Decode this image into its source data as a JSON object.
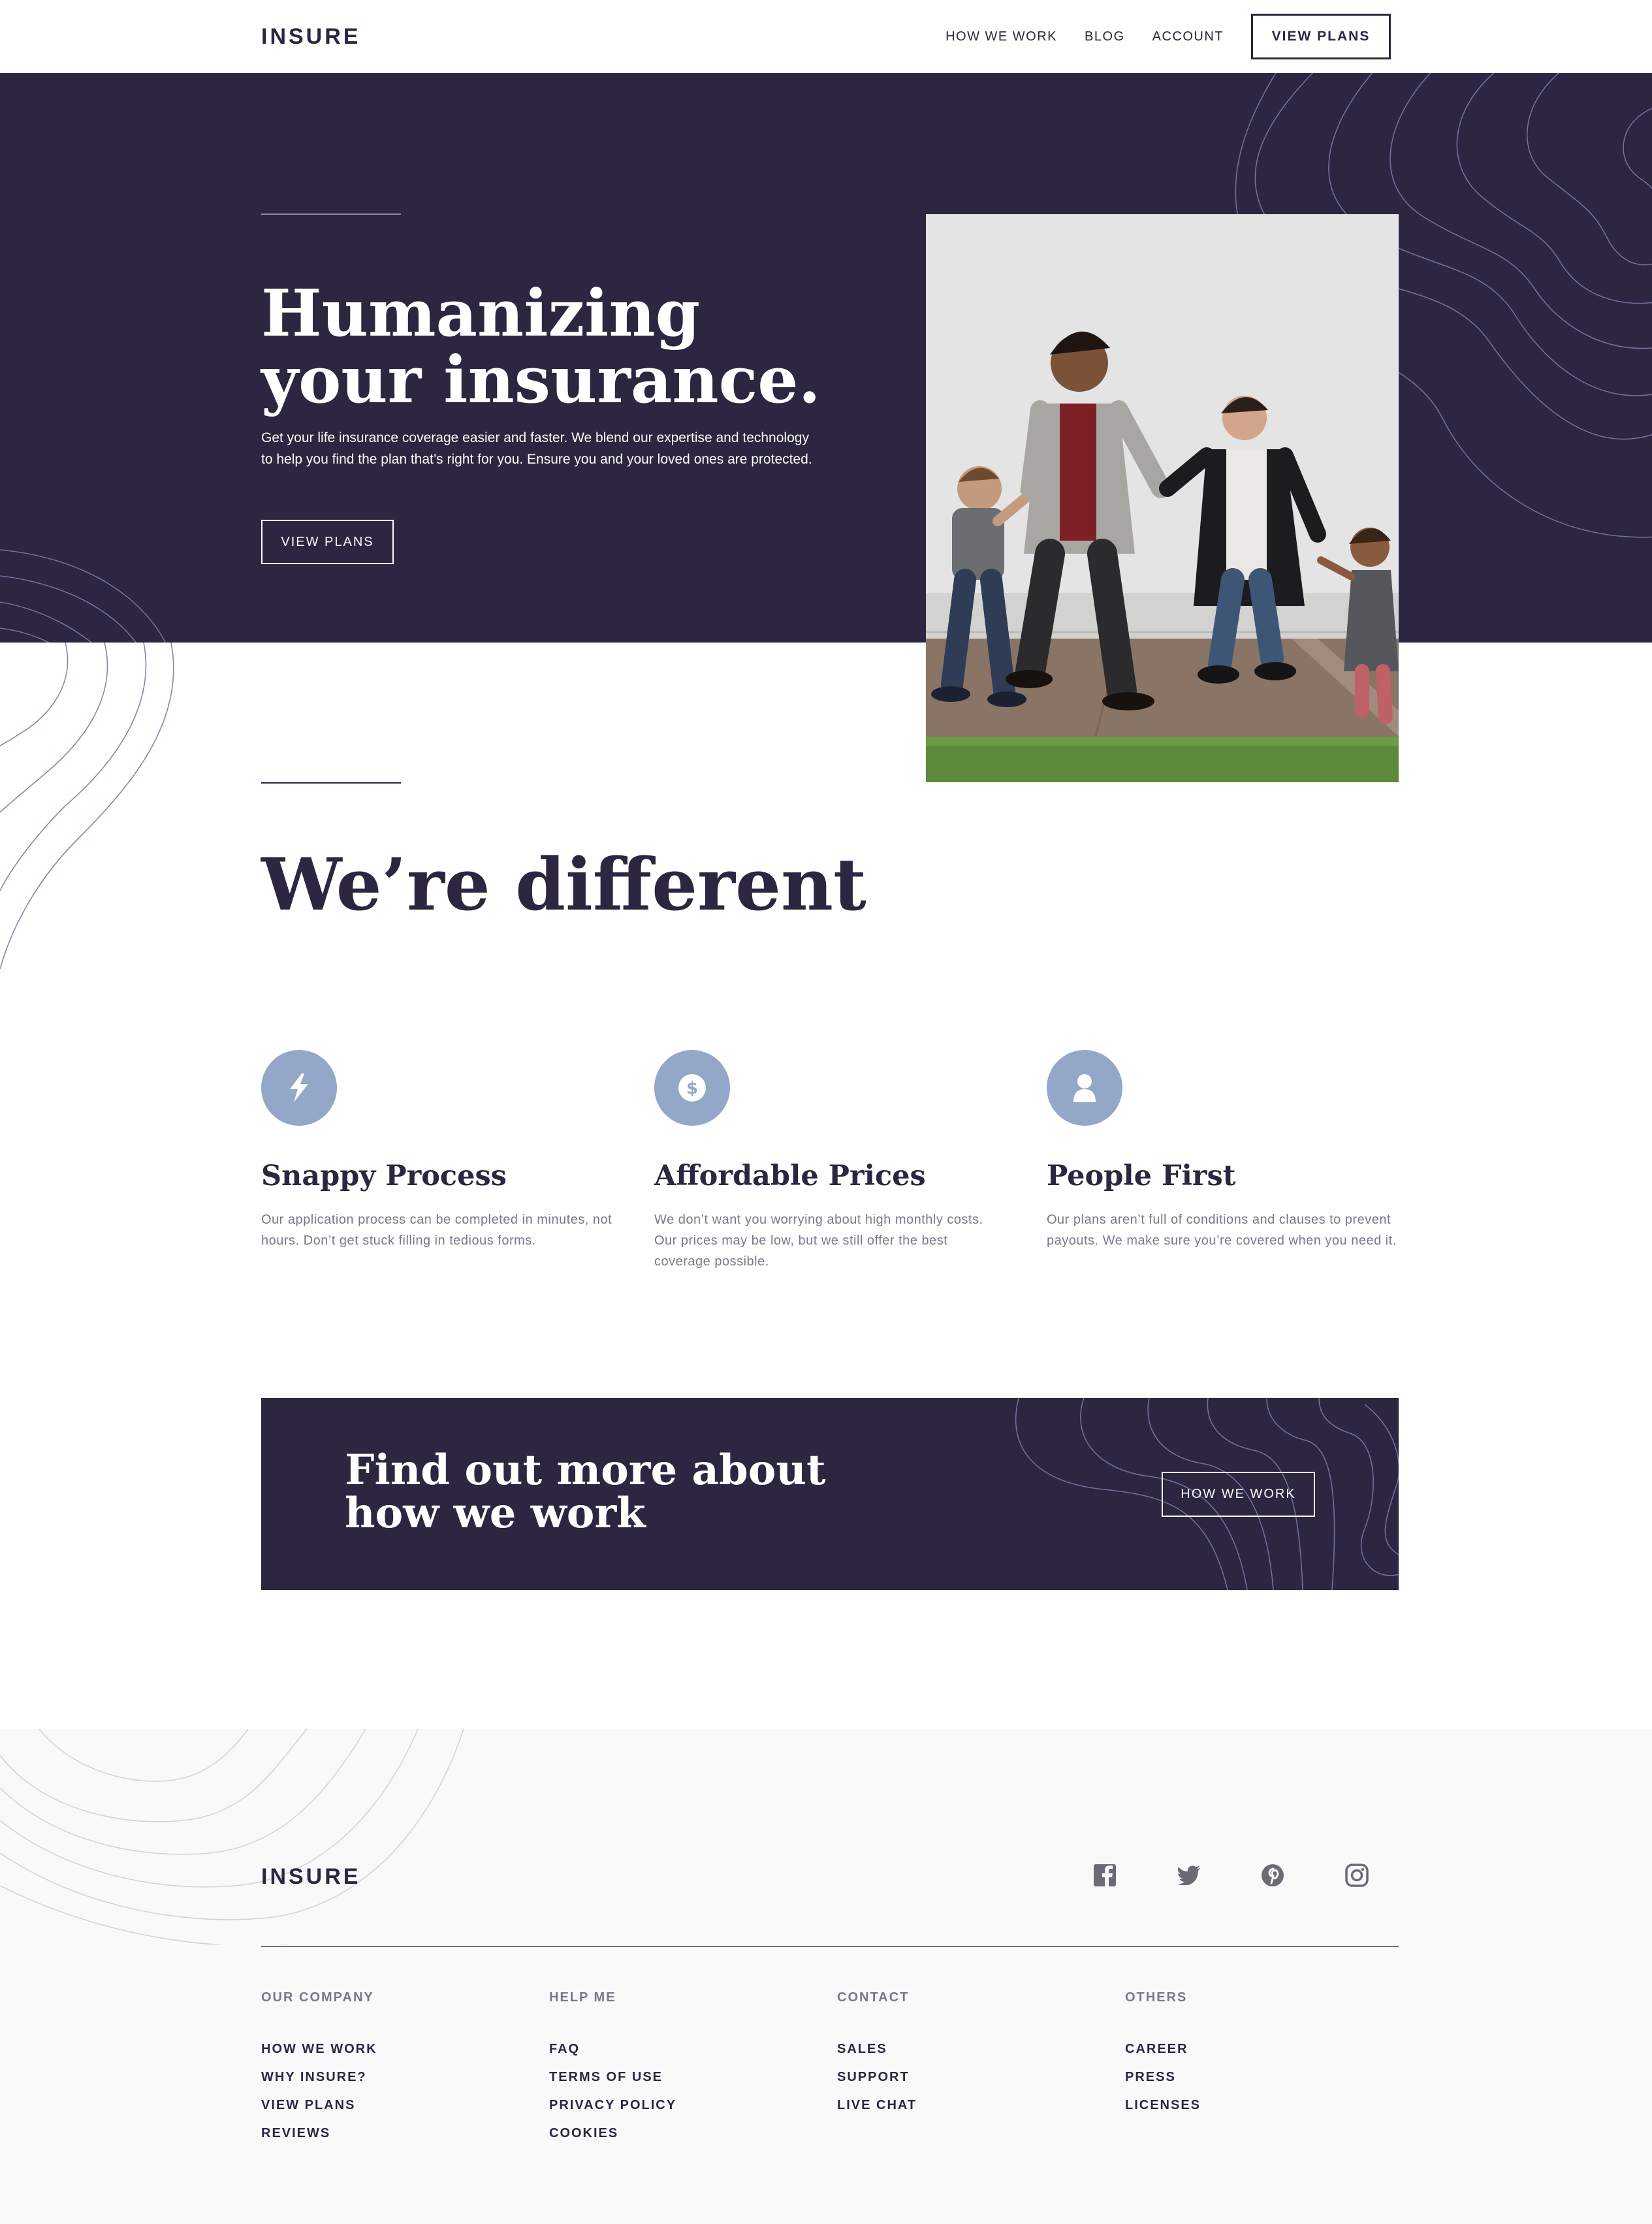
{
  "brand": {
    "name": "INSURE"
  },
  "header": {
    "nav": [
      "HOW WE WORK",
      "BLOG",
      "ACCOUNT"
    ],
    "cta_label": "VIEW PLANS"
  },
  "hero": {
    "title": "Humanizing your insurance.",
    "text": "Get your life insurance coverage easier and faster. We blend our expertise and technology to help you find the plan that’s right for you. Ensure you and your loved ones are protected.",
    "button_label": "VIEW PLANS"
  },
  "different": {
    "title": "We’re different",
    "features": [
      {
        "icon": "lightning-icon",
        "title": "Snappy Process",
        "text": "Our application process can be completed in minutes, not hours. Don’t get stuck filling in tedious forms."
      },
      {
        "icon": "dollar-icon",
        "title": "Affordable Prices",
        "text": "We don’t want you worrying about high monthly costs. Our prices may be low, but we still offer the best coverage possible."
      },
      {
        "icon": "person-icon",
        "title": "People First",
        "text": "Our plans aren’t full of conditions and clauses to prevent payouts. We make sure you’re covered when you need it."
      }
    ]
  },
  "cta": {
    "title": "Find out more about how we work",
    "button_label": "HOW WE WORK"
  },
  "footer": {
    "social": [
      "facebook-icon",
      "twitter-icon",
      "pinterest-icon",
      "instagram-icon"
    ],
    "columns": [
      {
        "heading": "OUR COMPANY",
        "links": [
          "HOW WE WORK",
          "WHY INSURE?",
          "VIEW PLANS",
          "REVIEWS"
        ]
      },
      {
        "heading": "HELP ME",
        "links": [
          "FAQ",
          "TERMS OF USE",
          "PRIVACY POLICY",
          "COOKIES"
        ]
      },
      {
        "heading": "CONTACT",
        "links": [
          "SALES",
          "SUPPORT",
          "LIVE CHAT"
        ]
      },
      {
        "heading": "OTHERS",
        "links": [
          "CAREER",
          "PRESS",
          "LICENSES"
        ]
      }
    ]
  },
  "colors": {
    "dark_violet": "#2c2640",
    "grayish_blue": "#93a8c8",
    "light_gray": "#f9f9f9"
  }
}
